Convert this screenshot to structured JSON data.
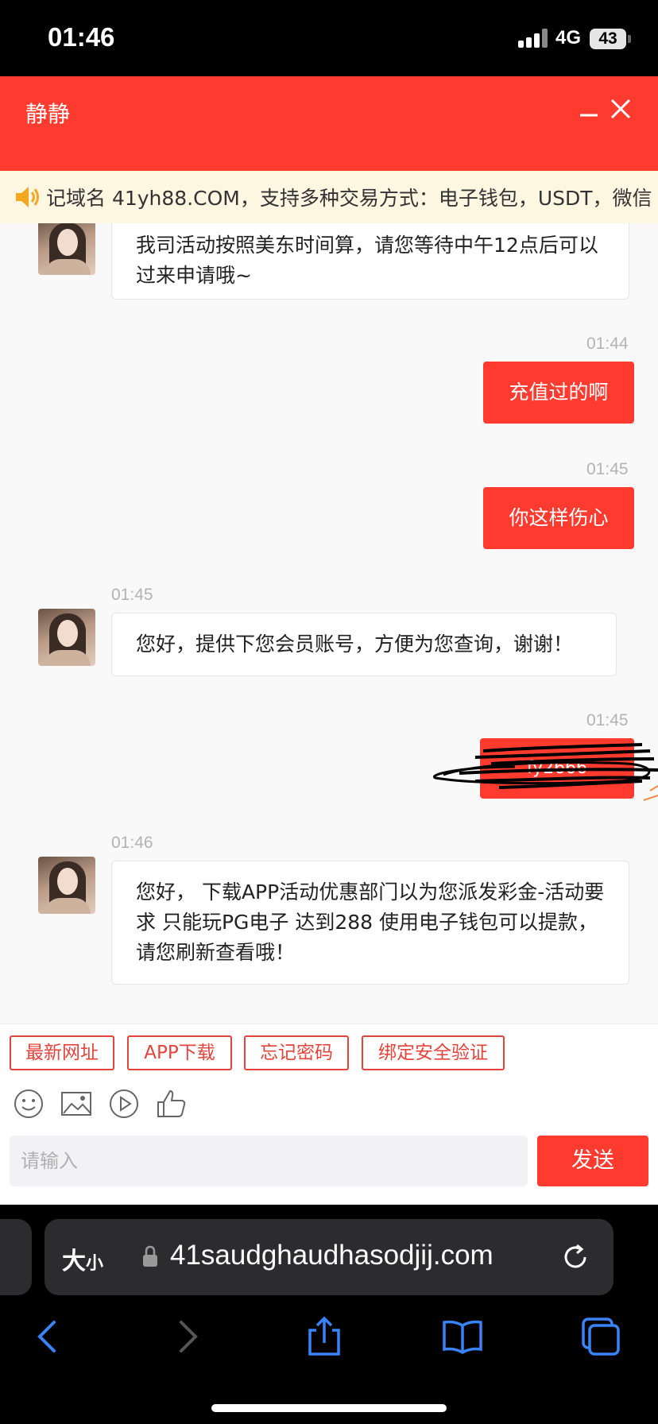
{
  "status_bar": {
    "time": "01:46",
    "network": "4G",
    "battery": "43"
  },
  "header": {
    "title": "静静"
  },
  "notice": {
    "text": "记域名 41yh88.COM，支持多种交易方式：电子钱包，USDT，微信"
  },
  "messages": [
    {
      "side": "left",
      "time": "",
      "text": "我司活动按照美东时间算，请您等待中午12点后可以过来申请哦~"
    },
    {
      "side": "right",
      "time": "01:44",
      "text": "充值过的啊"
    },
    {
      "side": "right",
      "time": "01:45",
      "text": "你这样伤心"
    },
    {
      "side": "left",
      "time": "01:45",
      "text": "您好，提供下您会员账号，方便为您查询，谢谢！"
    },
    {
      "side": "right",
      "time": "01:45",
      "text": "fy2666",
      "redacted": true
    },
    {
      "side": "left",
      "time": "01:46",
      "text": "您好， 下载APP活动优惠部门以为您派发彩金-活动要求 只能玩PG电子 达到288 使用电子钱包可以提款，请您刷新查看哦！"
    }
  ],
  "quick_buttons": [
    "最新网址",
    "APP下载",
    "忘记密码",
    "绑定安全验证"
  ],
  "toolbar_icons": [
    "emoji-icon",
    "image-icon",
    "video-icon",
    "thumbs-up-icon"
  ],
  "input": {
    "placeholder": "请输入",
    "value": ""
  },
  "send_label": "发送",
  "browser": {
    "text_size_label": "大",
    "text_size_small": "小",
    "url": "41saudghaudhasodjij.com"
  },
  "colors": {
    "accent": "#ff3b30",
    "notice_bg": "#fdf6e0",
    "ios_blue": "#3a82f7"
  }
}
